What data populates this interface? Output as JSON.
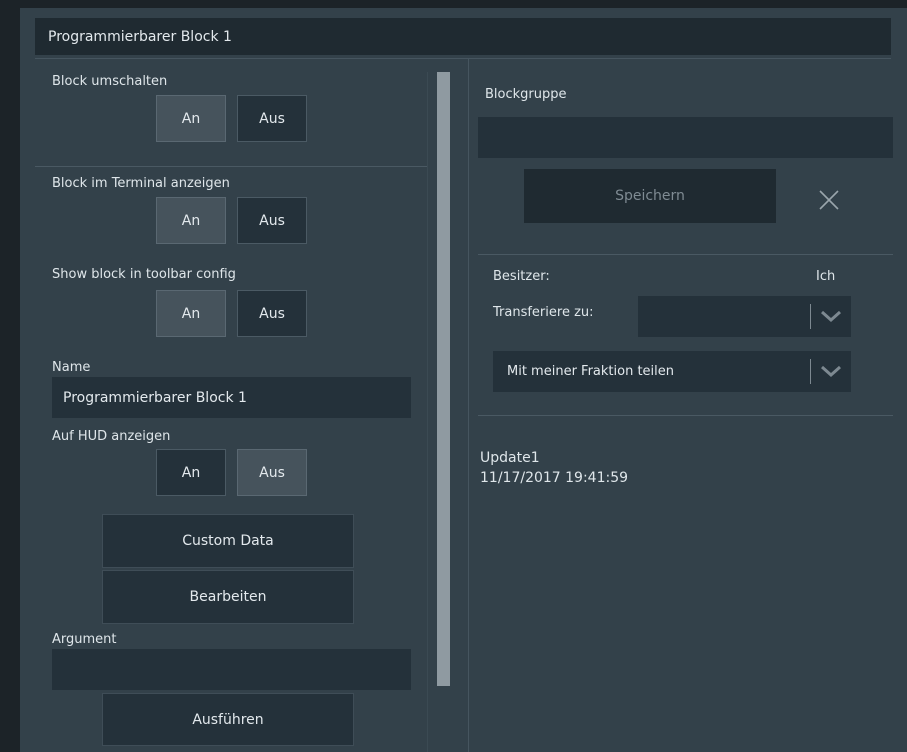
{
  "window": {
    "title": "Programmierbarer Block 1"
  },
  "left": {
    "toggle_block": {
      "label": "Block umschalten",
      "on": "An",
      "off": "Aus",
      "selected": "on"
    },
    "show_in_terminal": {
      "label": "Block im Terminal anzeigen",
      "on": "An",
      "off": "Aus",
      "selected": "on"
    },
    "show_in_toolbar": {
      "label": "Show block in toolbar config",
      "on": "An",
      "off": "Aus",
      "selected": "on"
    },
    "name": {
      "label": "Name",
      "value": "Programmierbarer Block 1"
    },
    "show_on_hud": {
      "label": "Auf HUD anzeigen",
      "on": "An",
      "off": "Aus",
      "selected": "off"
    },
    "custom_data_button": "Custom Data",
    "edit_button": "Bearbeiten",
    "argument": {
      "label": "Argument",
      "value": ""
    },
    "run_button": "Ausführen"
  },
  "right": {
    "block_group": {
      "label": "Blockgruppe",
      "value": ""
    },
    "save_button": "Speichern",
    "owner": {
      "label": "Besitzer:",
      "value": "Ich"
    },
    "transfer": {
      "label": "Transferiere zu:",
      "value": ""
    },
    "share": {
      "value": "Mit meiner Fraktion teilen"
    },
    "update": {
      "line1": "Update1",
      "line2": "11/17/2017 19:41:59"
    }
  },
  "colors": {
    "panel": "#33414a",
    "field": "#24313a",
    "selected_button": "#46535c"
  },
  "icons": {
    "close": "close-icon",
    "dropdown": "chevron-down-icon"
  }
}
